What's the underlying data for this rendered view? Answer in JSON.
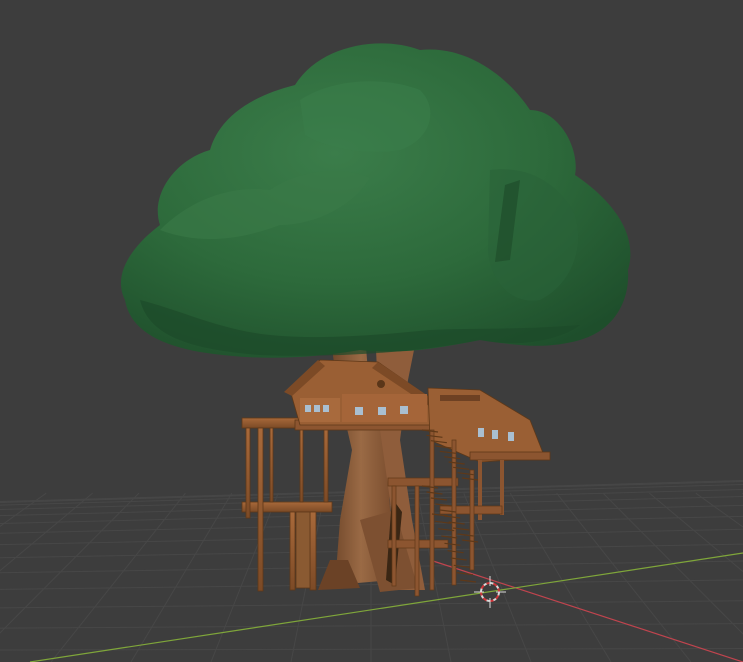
{
  "viewport": {
    "background": "#3d3d3d",
    "grid_color": "#474747",
    "x_axis_color": "#c0444e",
    "y_axis_color": "#7fa63a",
    "cursor_color": "#d9d9d9",
    "cursor_ring_color": "#d0353a"
  },
  "model": {
    "foliage_color": "#2f6e3f",
    "trunk_color": "#8f5d3b",
    "wood_color": "#9a5f34",
    "window_color": "#a9bfd1"
  },
  "icons": {
    "cursor": "3d-cursor-icon"
  }
}
